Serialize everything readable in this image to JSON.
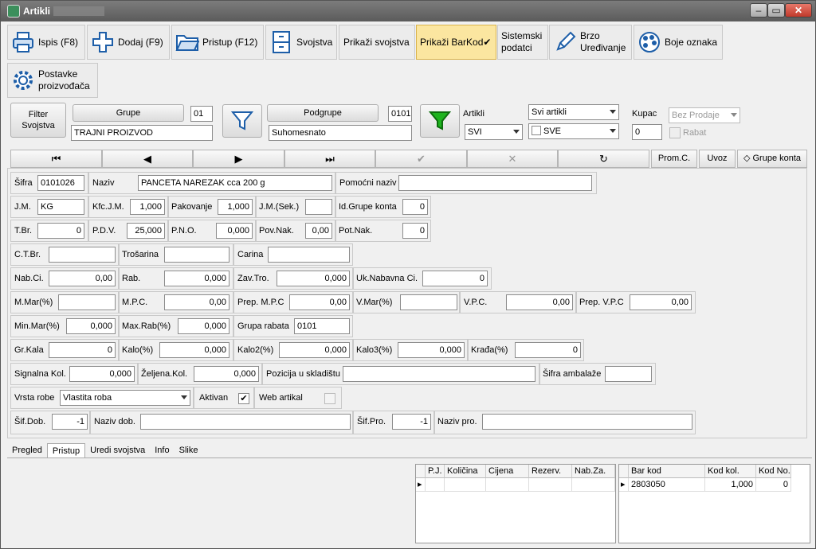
{
  "window": {
    "title": "Artikli",
    "min": "–",
    "max": "▭",
    "close": "✕"
  },
  "toolbar": {
    "ispis": "Ispis (F8)",
    "dodaj": "Dodaj (F9)",
    "pristup": "Pristup (F12)",
    "svojstva": "Svojstva",
    "prikazi_svojstva": "Prikaži svojstva",
    "prikazi_barkod": "Prikaži BarKod",
    "barkod_check": "✔",
    "sistemski_1": "Sistemski",
    "sistemski_2": "podatci",
    "brzo_1": "Brzo",
    "brzo_2": "Uređivanje",
    "boje": "Boje oznaka",
    "postavke_1": "Postavke",
    "postavke_2": "proizvođača"
  },
  "filter": {
    "filter_1": "Filter",
    "filter_2": "Svojstva",
    "grupe_label": "Grupe",
    "grupe_code": "01",
    "grupe_name": "TRAJNI PROIZVOD",
    "podgrupe_label": "Podgrupe",
    "podgrupe_code": "0101",
    "podgrupe_name": "Suhomesnato",
    "artikli_label": "Artikli",
    "artikli_sel": "SVI",
    "svi_artikli": "Svi artikli",
    "sve": "SVE",
    "kupac_label": "Kupac",
    "kupac_value": "0",
    "bez_prodaje": "Bez Prodaje",
    "rabat_label": "Rabat"
  },
  "nav": {
    "first": "⏮",
    "prev": "◀",
    "next": "▶",
    "last": "⏭",
    "ok": "✔",
    "cancel": "✕",
    "refresh": "↻",
    "promc": "Prom.C.",
    "uvoz": "Uvoz",
    "grupe_konta": "Grupe konta"
  },
  "form": {
    "sifra_l": "Šifra",
    "sifra": "0101026",
    "naziv_l": "Naziv",
    "naziv": "PANCETA NAREZAK cca 200 g",
    "pomocni_l": "Pomoćni naziv",
    "pomocni": "",
    "jm_l": "J.M.",
    "jm": "KG",
    "kfcjm_l": "Kfc.J.M.",
    "kfcjm": "1,000",
    "pakovanje_l": "Pakovanje",
    "pakovanje": "1,000",
    "jmsek_l": "J.M.(Sek.)",
    "jmsek": "",
    "idgrupe_l": "Id.Grupe konta",
    "idgrupe": "0",
    "tbr_l": "T.Br.",
    "tbr": "0",
    "pdv_l": "P.D.V.",
    "pdv": "25,000",
    "pno_l": "P.N.O.",
    "pno": "0,000",
    "povnak_l": "Pov.Nak.",
    "povnak": "0,00",
    "potnak_l": "Pot.Nak.",
    "potnak": "0",
    "ctbr_l": "C.T.Br.",
    "ctbr": "",
    "trosarina_l": "Trošarina",
    "trosarina": "",
    "carina_l": "Carina",
    "carina": "",
    "nabci_l": "Nab.Ci.",
    "nabci": "0,00",
    "rab_l": "Rab.",
    "rab": "0,000",
    "zavtro_l": "Zav.Tro.",
    "zavtro": "0,000",
    "uknab_l": "Uk.Nabavna Ci.",
    "uknab": "0",
    "mmar_l": "M.Mar(%)",
    "mmar": "",
    "mpc_l": "M.P.C.",
    "mpc": "0,00",
    "prepmpc_l": "Prep. M.P.C",
    "prepmpc": "0,00",
    "vmar_l": "V.Mar(%)",
    "vmar": "",
    "vpc_l": "V.P.C.",
    "vpc": "0,00",
    "prepvpc_l": "Prep. V.P.C",
    "prepvpc": "0,00",
    "minmar_l": "Min.Mar(%)",
    "minmar": "0,000",
    "maxrab_l": "Max.Rab(%)",
    "maxrab": "0,000",
    "gruparab_l": "Grupa rabata",
    "gruparab": "0101",
    "grkala_l": "Gr.Kala",
    "grkala": "0",
    "kalo_l": "Kalo(%)",
    "kalo": "0,000",
    "kalo2_l": "Kalo2(%)",
    "kalo2": "0,000",
    "kalo3_l": "Kalo3(%)",
    "kalo3": "0,000",
    "krada_l": "Krađa(%)",
    "krada": "0",
    "signalna_l": "Signalna Kol.",
    "signalna": "0,000",
    "zeljena_l": "Željena.Kol.",
    "zeljena": "0,000",
    "pozicija_l": "Pozicija u skladištu",
    "pozicija": "",
    "sifamb_l": "Šifra ambalaže",
    "sifamb": "",
    "vrsta_l": "Vrsta robe",
    "vrsta": "Vlastita roba",
    "aktivan_l": "Aktivan",
    "aktivan_chk": "✔",
    "web_l": "Web artikal",
    "sifdob_l": "Šif.Dob.",
    "sifdob": "-1",
    "nazivdob_l": "Naziv dob.",
    "nazivdob": "",
    "sifpro_l": "Šif.Pro.",
    "sifpro": "-1",
    "nazivpro_l": "Naziv pro.",
    "nazivpro": ""
  },
  "tabs": [
    "Pregled",
    "Pristup",
    "Uredi svojstva",
    "Info",
    "Slike"
  ],
  "grid1": {
    "headers": [
      "P.J.",
      "Količina",
      "Cijena",
      "Rezerv.",
      "Nab.Za."
    ]
  },
  "grid2": {
    "headers": [
      "Bar kod",
      "Kod kol.",
      "Kod No."
    ],
    "row": [
      "2803050",
      "1,000",
      "0"
    ]
  },
  "colors": {
    "accent": "#fbe6a0",
    "funnel_green": "#1db31d"
  }
}
